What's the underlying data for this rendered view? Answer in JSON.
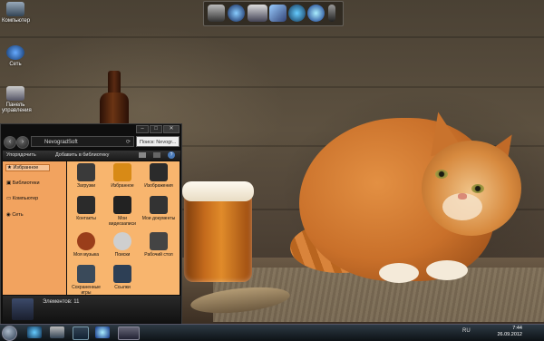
{
  "desktop": {
    "icons": [
      {
        "label": "Компьютер",
        "icon": "computer-icon"
      },
      {
        "label": "Сеть",
        "icon": "network-icon"
      },
      {
        "label": "Панель управления",
        "icon": "control-panel-icon"
      }
    ]
  },
  "dock": {
    "items": [
      "monitor-icon",
      "globe-icon",
      "hdd-icon",
      "mail-icon",
      "ie-icon",
      "media-player-icon",
      "usb-icon"
    ]
  },
  "explorer": {
    "address": "NevogradSoft",
    "search_placeholder": "Поиск: Nevogr...",
    "toolbar": {
      "organize": "Упорядочить",
      "add_to_library": "Добавить в библиотеку"
    },
    "nav": [
      {
        "label": "Избранное",
        "selected": true
      },
      {
        "label": "Библиотеки",
        "selected": false
      },
      {
        "label": "Компьютер",
        "selected": false
      },
      {
        "label": "Сеть",
        "selected": false
      }
    ],
    "items": [
      {
        "label": "Загрузки",
        "icon": "downloads-icon",
        "color": "#3a3a3a"
      },
      {
        "label": "Избранное",
        "icon": "favorites-star-icon",
        "color": "#d88a16"
      },
      {
        "label": "Изображения",
        "icon": "camera-icon",
        "color": "#2b2b2b"
      },
      {
        "label": "Контакты",
        "icon": "contacts-icon",
        "color": "#2b2b2b"
      },
      {
        "label": "Мои видеозаписи",
        "icon": "film-icon",
        "color": "#222"
      },
      {
        "label": "Мои документы",
        "icon": "documents-icon",
        "color": "#333"
      },
      {
        "label": "Моя музыка",
        "icon": "music-icon",
        "color": "#9a3e1a"
      },
      {
        "label": "Поиски",
        "icon": "magnifier-icon",
        "color": "#cfcfcf"
      },
      {
        "label": "Рабочий стол",
        "icon": "desktop-folder-icon",
        "color": "#444"
      },
      {
        "label": "Сохраненные игры",
        "icon": "games-icon",
        "color": "#3a4a5a"
      },
      {
        "label": "Ссылки",
        "icon": "links-icon",
        "color": "#2d3f55"
      }
    ],
    "status": "Элементов: 11"
  },
  "taskbar": {
    "items": [
      "ie-taskbar-icon",
      "explorer-taskbar-icon",
      "media-taskbar-icon",
      "monitor-taskbar-icon",
      "window-taskbar-icon"
    ],
    "language": "RU",
    "time": "7:44",
    "date": "26.09.2012"
  }
}
